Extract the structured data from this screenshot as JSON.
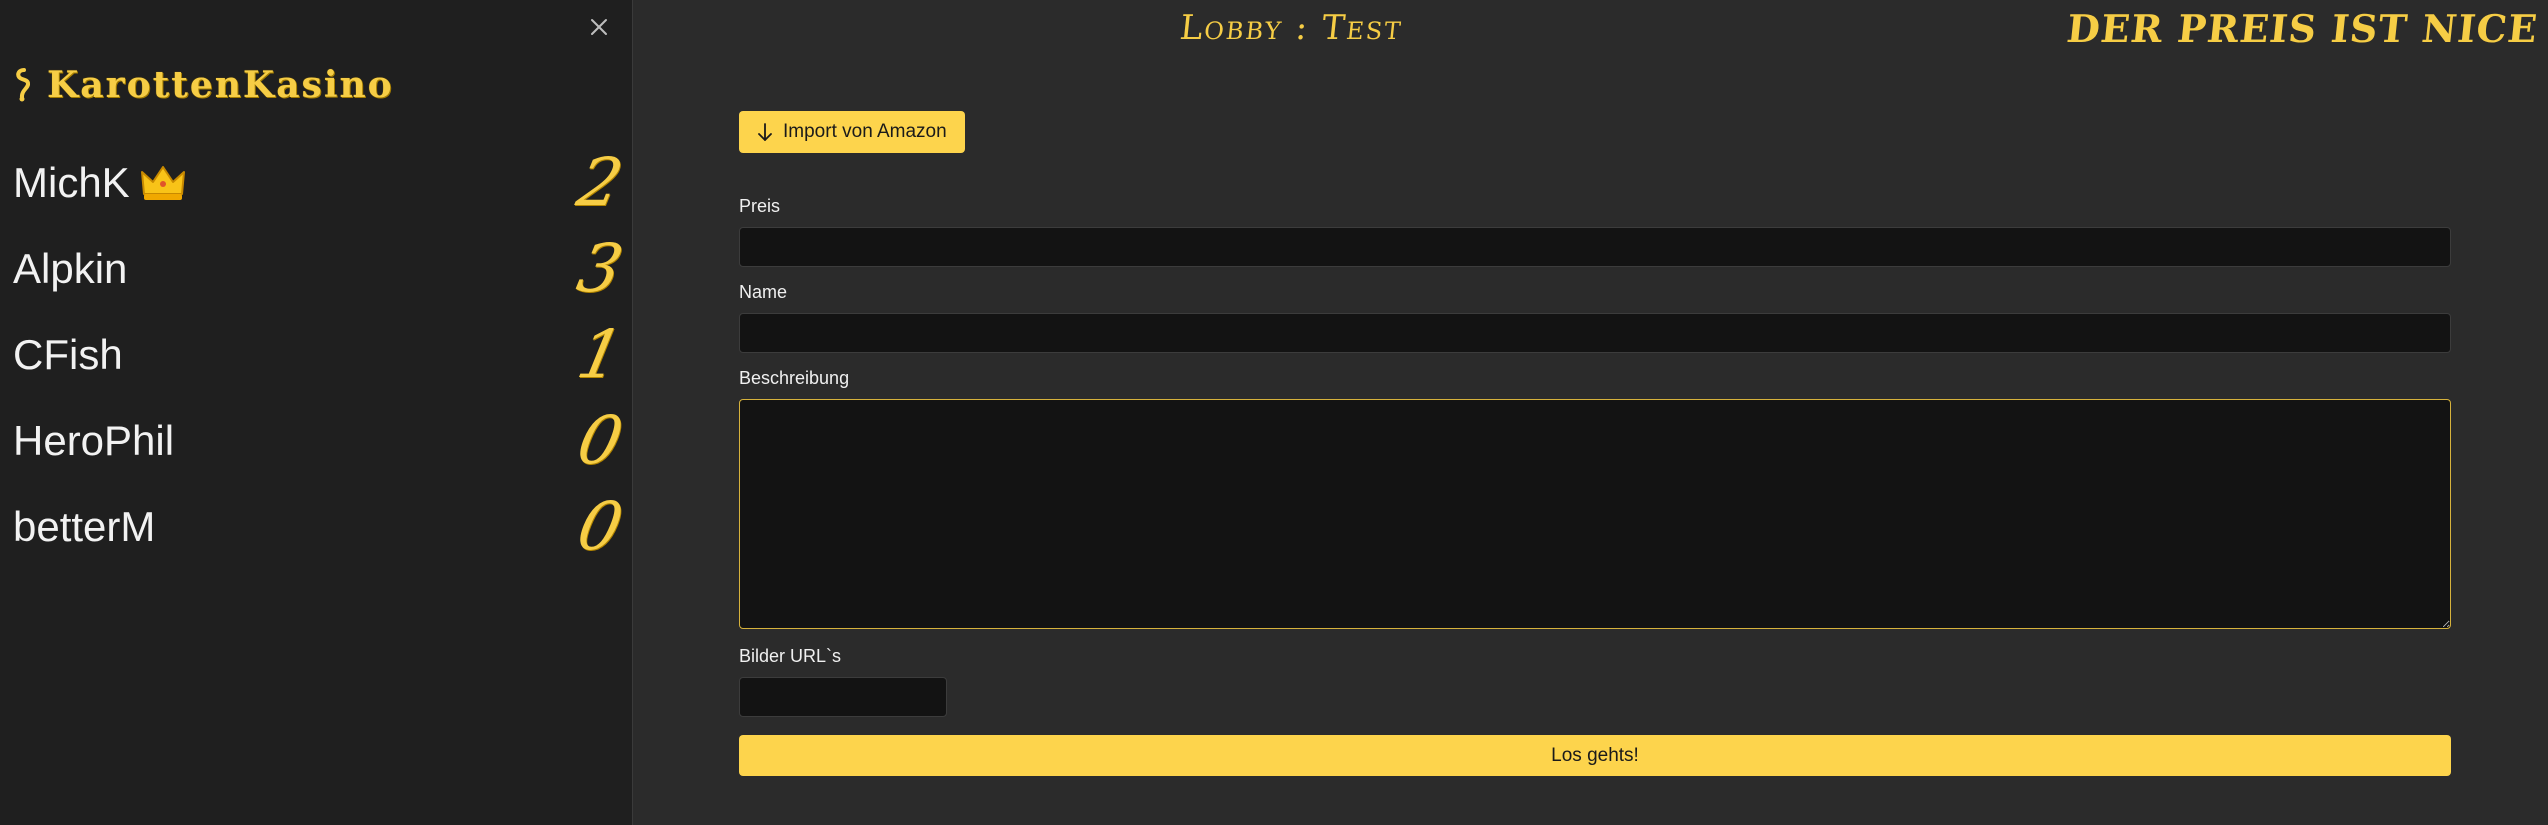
{
  "sidebar": {
    "brand": "KarottenKasino",
    "players": [
      {
        "name": "MichK",
        "score": "2",
        "crown": true
      },
      {
        "name": "Alpkin",
        "score": "3",
        "crown": false
      },
      {
        "name": "CFish",
        "score": "1",
        "crown": false
      },
      {
        "name": "HeroPhil",
        "score": "0",
        "crown": false
      },
      {
        "name": "betterM",
        "score": "0",
        "crown": false
      }
    ]
  },
  "header": {
    "lobby_title": "Lobby : Test",
    "game_title": "DER PREIS IST NICE"
  },
  "form": {
    "import_label": "Import von Amazon",
    "price_label": "Preis",
    "price_value": "",
    "name_label": "Name",
    "name_value": "",
    "description_label": "Beschreibung",
    "description_value": "",
    "images_label": "Bilder URL`s",
    "images_value": "",
    "submit_label": "Los gehts!"
  },
  "colors": {
    "accent": "#fdd44c",
    "sidebar_bg": "#1f1f1f",
    "main_bg": "#2b2b2b",
    "input_bg": "#131313"
  },
  "icons": {
    "close": "close-icon",
    "brand": "carrot-icon",
    "crown": "crown-icon",
    "import": "arrow-down-icon"
  }
}
